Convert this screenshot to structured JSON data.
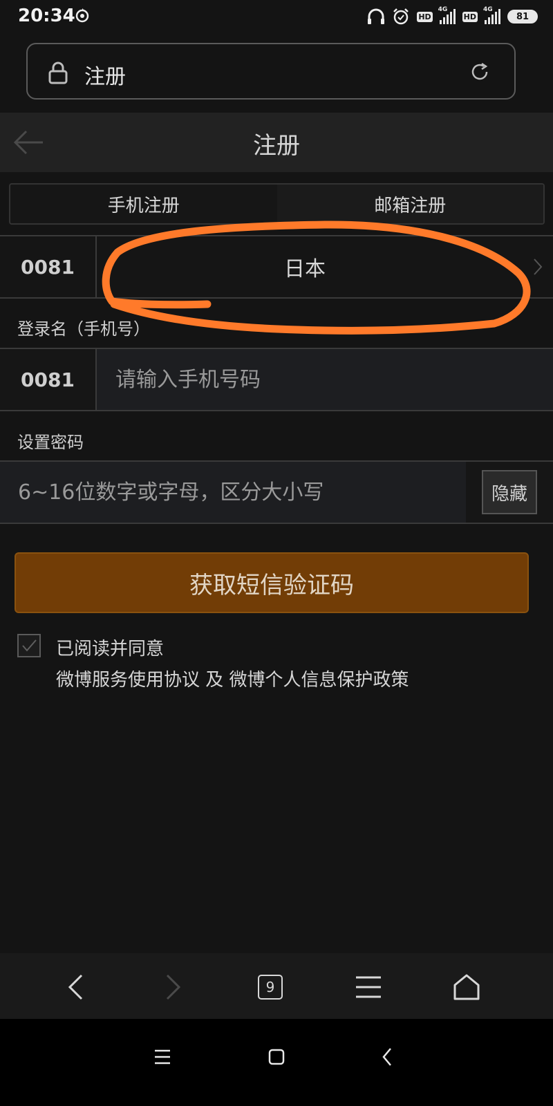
{
  "status_bar": {
    "time": "20:34",
    "hd_label": "HD",
    "network_label": "4G",
    "battery": "81"
  },
  "address_bar": {
    "title": "注册"
  },
  "page": {
    "title": "注册",
    "tabs": [
      {
        "label": "手机注册",
        "selected": true
      },
      {
        "label": "邮箱注册",
        "selected": false
      }
    ],
    "country": {
      "code": "0081",
      "name": "日本"
    },
    "login_label": "登录名（手机号）",
    "phone": {
      "code": "0081",
      "value": "",
      "placeholder": "请输入手机号码"
    },
    "password_label": "设置密码",
    "password": {
      "value": "",
      "placeholder": "6~16位数字或字母，区分大小写",
      "toggle_label": "隐藏"
    },
    "submit_label": "获取短信验证码",
    "agreement": {
      "checked": true,
      "line1": "已阅读并同意",
      "line2": "微博服务使用协议 及 微博个人信息保护政策"
    }
  },
  "browser_toolbar": {
    "tab_count": "9"
  },
  "colors": {
    "background": "#141414",
    "submit": "#723d06",
    "annotation": "#ff7a2a"
  }
}
